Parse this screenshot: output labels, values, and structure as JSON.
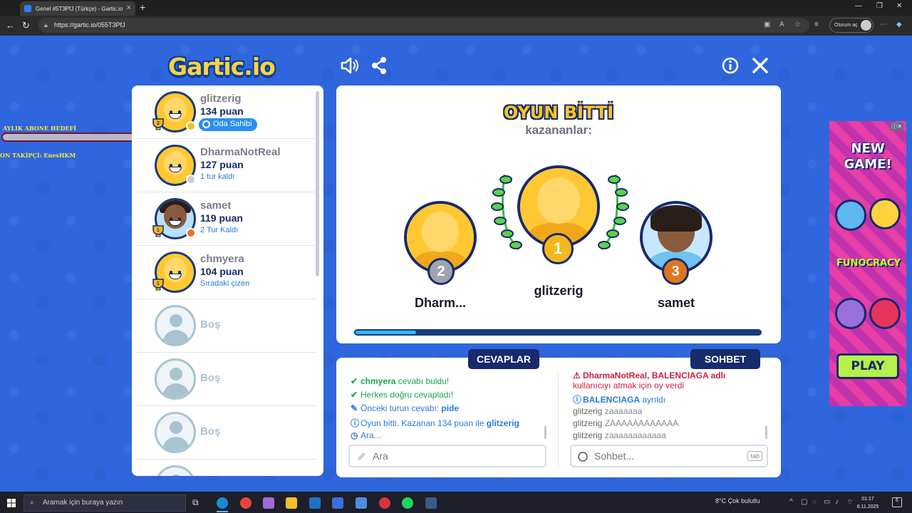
{
  "browser": {
    "tab_title": "Genel #5T3PfJ (Türkçe) - Gartic.io",
    "url": "https://gartic.io/055T3PfJ",
    "signin_label": "Oturum aç"
  },
  "overlay": {
    "sub_goal": "AYLIK ABONE HEDEFİ",
    "last_follower": "ON TAKİPÇİ: EnesHKM",
    "goal_progress": 0
  },
  "logo": "Gartic.io",
  "players": [
    {
      "name": "glitzerig",
      "points": "134 puan",
      "status": "Oda Sahibi",
      "owner": true,
      "trophy": "2",
      "dot_color": "#f5c021",
      "dark": false
    },
    {
      "name": "DharmaNotReal",
      "points": "127 puan",
      "status": "1 tur kaldı",
      "owner": false,
      "trophy": "",
      "dot_color": "#c8ccd4",
      "dark": false
    },
    {
      "name": "samet",
      "points": "119 puan",
      "status": "2 Tur Kaldı",
      "owner": false,
      "trophy": "1",
      "dot_color": "#e0751f",
      "dark": true
    },
    {
      "name": "chmyera",
      "points": "104 puan",
      "status": "Sıradaki çizen",
      "owner": false,
      "trophy": "1",
      "dot_color": "",
      "dark": false
    }
  ],
  "empty_slot_label": "Boş",
  "result": {
    "title": "OYUN BİTTİ",
    "subtitle": "kazananlar:",
    "first": {
      "name": "glitzerig",
      "rank": "1"
    },
    "second": {
      "name": "Dharm...",
      "rank": "2"
    },
    "third": {
      "name": "samet",
      "rank": "3"
    },
    "progress_fraction": 0.15
  },
  "answers": {
    "tab_label": "CEVAPLAR",
    "messages": [
      {
        "icon": "✔",
        "class": "green",
        "parts": [
          {
            "t": "chmyera",
            "b": true
          },
          {
            "t": " cevabı buldu!",
            "b": false
          }
        ]
      },
      {
        "icon": "✔",
        "class": "green",
        "parts": [
          {
            "t": "Herkes doğru cevapladı!",
            "b": false
          }
        ]
      },
      {
        "icon": "✎",
        "class": "blue",
        "parts": [
          {
            "t": "Önceki turun cevabı: ",
            "b": false
          },
          {
            "t": "pide",
            "b": true
          }
        ]
      },
      {
        "icon": "ⓘ",
        "class": "blue",
        "parts": [
          {
            "t": "Oyun bitti. Kazanan 134 puan ile ",
            "b": false
          },
          {
            "t": "glitzerig",
            "b": true
          }
        ]
      },
      {
        "icon": "◷",
        "class": "blue",
        "parts": [
          {
            "t": "Ara...",
            "b": false
          }
        ]
      }
    ],
    "placeholder": "Ara"
  },
  "chat": {
    "tab_label": "SOHBET",
    "warning_line1": "DharmaNotReal, BALENCIAGA adlı",
    "warning_line2": "kullanıcıyı atmak için oy verdi",
    "left_user": "BALENCIAGA",
    "left_text": " ayrıldı",
    "messages": [
      {
        "user": "glitzerig",
        "text": "zaaaaaaa"
      },
      {
        "user": "glitzerig",
        "text": "ZAAAAAAAAAAAA"
      },
      {
        "user": "glitzerig",
        "text": "zaaaaaaaaaaaa"
      }
    ],
    "placeholder": "Sohbet...",
    "tab_key": "tab"
  },
  "ad": {
    "headline_1": "NEW",
    "headline_2": "GAME!",
    "brand": "FUNOCRACY",
    "cta": "PLAY"
  },
  "taskbar": {
    "search_placeholder": "Aramak için buraya yazın",
    "weather": "8°C  Çok bulutlu",
    "time": "01:17",
    "date": "8.11.2025",
    "notifications": "6"
  }
}
